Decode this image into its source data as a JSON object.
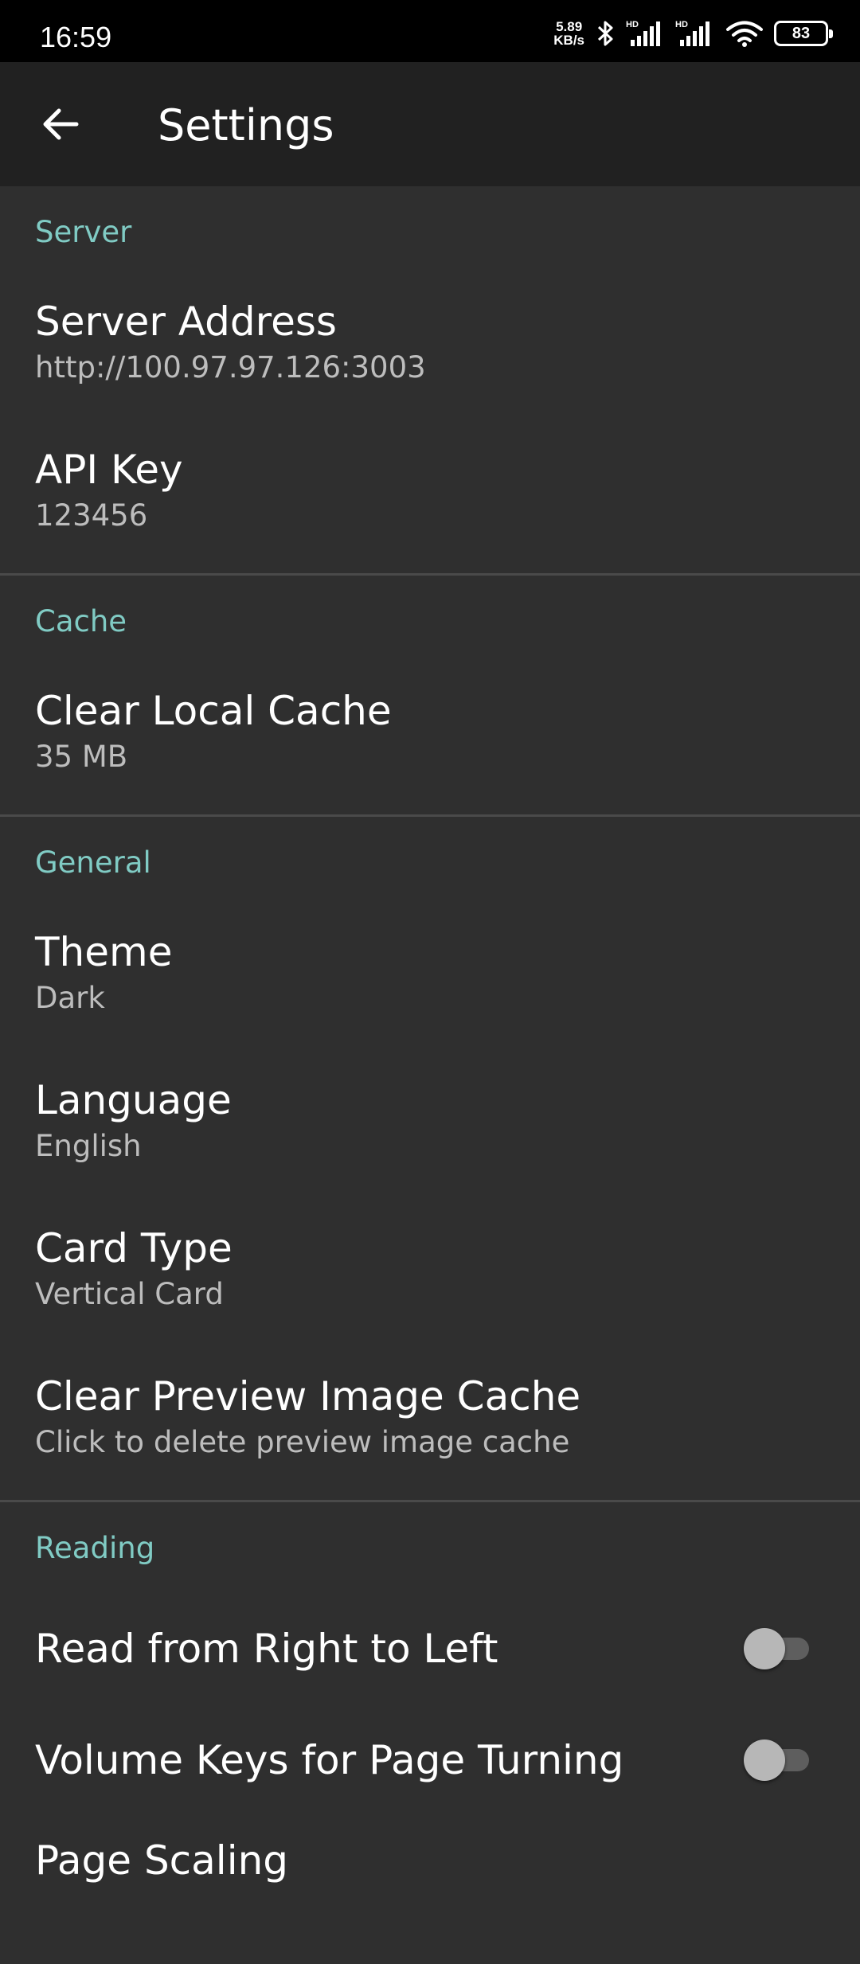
{
  "status_bar": {
    "time": "16:59",
    "net_speed_value": "5.89",
    "net_speed_unit": "KB/s",
    "battery": "83",
    "icons": [
      "bluetooth-icon",
      "hd-signal-icon",
      "hd-signal-icon",
      "wifi-icon",
      "battery-icon"
    ]
  },
  "app_bar": {
    "title": "Settings",
    "back_icon": "arrow-back-icon"
  },
  "sections": {
    "server": {
      "header": "Server",
      "server_address": {
        "title": "Server Address",
        "summary": "http://100.97.97.126:3003"
      },
      "api_key": {
        "title": "API Key",
        "summary": "123456"
      }
    },
    "cache": {
      "header": "Cache",
      "clear_local_cache": {
        "title": "Clear Local Cache",
        "summary": "35 MB"
      }
    },
    "general": {
      "header": "General",
      "theme": {
        "title": "Theme",
        "summary": "Dark"
      },
      "language": {
        "title": "Language",
        "summary": "English"
      },
      "card_type": {
        "title": "Card Type",
        "summary": "Vertical Card"
      },
      "clear_preview_cache": {
        "title": "Clear Preview Image Cache",
        "summary": "Click to delete preview image cache"
      }
    },
    "reading": {
      "header": "Reading",
      "rtl": {
        "title": "Read from Right to Left",
        "checked": false
      },
      "volume_keys": {
        "title": "Volume Keys for Page Turning",
        "checked": false
      },
      "page_scaling": {
        "title": "Page Scaling"
      }
    }
  },
  "colors": {
    "accent": "#80cbc4",
    "background": "#2f2f2f",
    "app_bar": "#212121",
    "status_bar": "#000000"
  }
}
